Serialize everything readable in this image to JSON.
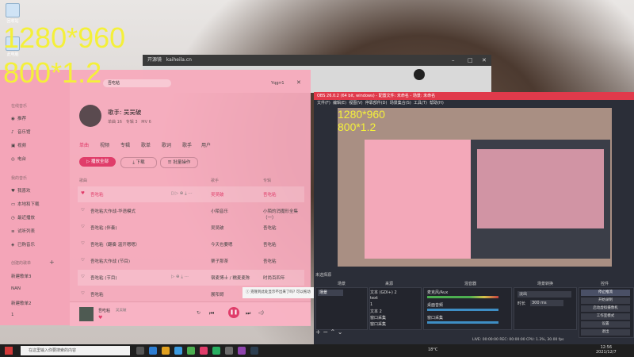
{
  "overlay": {
    "line1": "1280*960",
    "line2": "800*1.2"
  },
  "desktop": {
    "icons": [
      {
        "label": "回收站"
      },
      {
        "label": "此电脑"
      }
    ]
  },
  "browser": {
    "tab_label": "开源镜",
    "url": "kaiheila.cn"
  },
  "music": {
    "search_placeholder": "吾吃粘",
    "user_name": "Yqgrr1",
    "sidebar": {
      "section1": "在线音乐",
      "items1": [
        "推荐",
        "音乐馆",
        "视频",
        "电台"
      ],
      "section2": "我的音乐",
      "items2": [
        "我喜欢",
        "本地和下载",
        "最近播放",
        "试听列表",
        "已购音乐"
      ],
      "section3": "创建的歌单",
      "items3": [
        "新建歌单3",
        "NAN",
        "新建歌单2",
        "1"
      ]
    },
    "artist": {
      "name": "歌手: 吴吴破",
      "stats": [
        "单曲 16",
        "专辑 3",
        "MV 6"
      ]
    },
    "tabs": [
      "单曲",
      "视频",
      "专辑",
      "歌单",
      "歌词",
      "歌手",
      "用户"
    ],
    "buttons": {
      "play_all": "播放全部",
      "download": "下载",
      "batch": "批量操作"
    },
    "columns": {
      "song": "歌曲",
      "artist": "歌手",
      "album": "专辑"
    },
    "songs": [
      {
        "title": "吾吃粘",
        "artist": "吴吴破",
        "album": "吾吃粘"
      },
      {
        "title": "吾吃粘大作战-华语模式",
        "artist": "小陌音乐",
        "album": "小陌的消魔形全集（一）"
      },
      {
        "title": "吾吃粘 (伴奏)",
        "artist": "吴吴破",
        "album": "吾吃粘"
      },
      {
        "title": "吾吃粘（翻奏 温开嗯嗯）",
        "artist": "今天也要嗯",
        "album": "吾吃粘"
      },
      {
        "title": "吾吃粘大作战 (节目)",
        "artist": "栗子那茶",
        "album": "吾吃粘"
      },
      {
        "title": "吾吃粘 (节目)",
        "artist": "宿麦博士 / 糯麦麦陈",
        "album": "时尚百四年"
      },
      {
        "title": "吾吃粘",
        "artist": "展阳哥",
        "album": ""
      }
    ],
    "player": {
      "now_title": "吾吃粘",
      "now_artist": "吴吴破"
    },
    "tooltip": "克隆到此处显示不出来了吗? 可以拖动"
  },
  "obs": {
    "title": "OBS 26.0.2 (64 bit, windows) - 配置文件: 未命名 - 场景: 未命名",
    "menu": [
      "文件(F)",
      "编辑(E)",
      "视图(V)",
      "停靠部件(D)",
      "场景集合(S)",
      "工具(T)",
      "帮助(H)"
    ],
    "docks": {
      "scenes": "场景",
      "sources": "来源",
      "mixer": "混音器",
      "transitions": "场景转换",
      "controls": "控件"
    },
    "scene_item": "场景",
    "sources": [
      "文本 (GDI+) 2",
      "text",
      "1",
      "文本 2",
      "窗口采集",
      "窗口采集"
    ],
    "mixer_tracks": [
      "麦克风/Aux",
      "桌面音频",
      "窗口采集"
    ],
    "transition": {
      "type": "淡出",
      "duration_label": "时长",
      "duration": "300 ms"
    },
    "controls": [
      "停止推流",
      "开始录制",
      "启动虚拟摄像机",
      "工作室模式",
      "设置",
      "退出"
    ],
    "status": "LIVE: 00:00:00  REC: 00:00:00  CPU: 1.3%, 30.00 fps"
  },
  "taskbar": {
    "search_placeholder": "在这里输入你要搜索的内容",
    "weather": "18°C",
    "time": "12:56",
    "date": "2021/12/7"
  },
  "colors": {
    "accent": "#e03d6a",
    "obs_title": "#e03a4b",
    "overlay": "#f4f03a"
  }
}
